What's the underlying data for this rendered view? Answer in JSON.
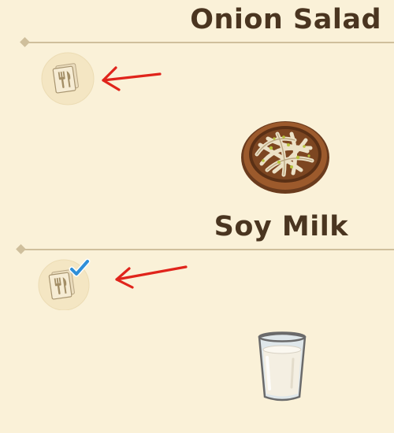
{
  "recipes": [
    {
      "name": "Onion Salad",
      "icon": "recipe-card-icon",
      "cooked": false,
      "dish": "onion-salad-dish-icon"
    },
    {
      "name": "Soy Milk",
      "icon": "recipe-card-icon",
      "cooked": true,
      "dish": "soy-milk-glass-icon"
    }
  ],
  "annotation": {
    "arrow_icon": "red-arrow-icon",
    "arrow_color": "#e0241b"
  },
  "colors": {
    "background": "#faf1d8",
    "title": "#4a3520",
    "divider": "#cfbf9c",
    "check": "#2f8fd8"
  }
}
